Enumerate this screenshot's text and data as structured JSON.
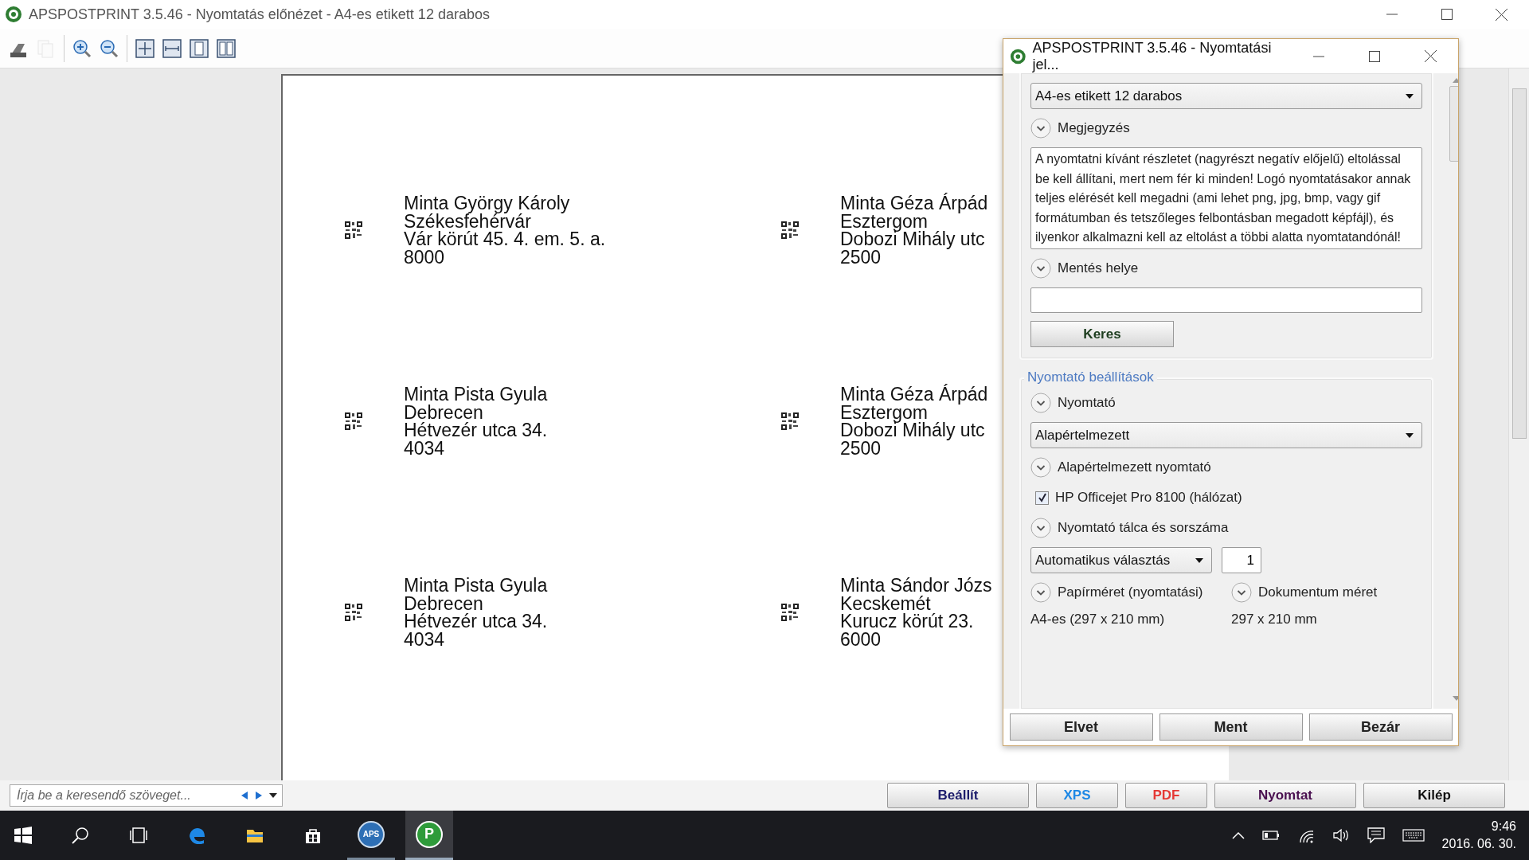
{
  "window": {
    "title": "APSPOSTPRINT 3.5.46 - Nyomtatás előnézet - A4-es etikett 12 darabos"
  },
  "toolbar": [
    {
      "kind": "print",
      "disabled": false
    },
    {
      "kind": "copy",
      "disabled": true
    },
    {
      "kind": "zoom-in",
      "disabled": false
    },
    {
      "kind": "zoom-out",
      "disabled": false
    },
    {
      "kind": "fit-page",
      "disabled": false
    },
    {
      "kind": "fit-width",
      "disabled": false
    },
    {
      "kind": "one-page",
      "disabled": false
    },
    {
      "kind": "two-pages",
      "disabled": false
    }
  ],
  "labels": [
    {
      "lines": [
        "Minta György Károly",
        "Székesfehérvár",
        "Vár körút 45. 4. em. 5. a.",
        "8000"
      ]
    },
    {
      "lines": [
        "Minta Géza Árpád",
        "Esztergom",
        "Dobozi Mihály utc",
        "2500"
      ]
    },
    {
      "lines": [
        "Minta Pista Gyula",
        "Debrecen",
        "Hétvezér utca 34.",
        "4034"
      ]
    },
    {
      "lines": [
        "Minta Géza Árpád",
        "Esztergom",
        "Dobozi Mihály utc",
        "2500"
      ]
    },
    {
      "lines": [
        "Minta Pista Gyula",
        "Debrecen",
        "Hétvezér utca 34.",
        "4034"
      ]
    },
    {
      "lines": [
        "Minta Sándor Józs",
        "Kecskemét",
        "Kurucz körút 23.",
        "6000"
      ]
    }
  ],
  "dialog": {
    "title": "APSPOSTPRINT 3.5.46 - Nyomtatási jel...",
    "template": "A4-es etikett 12 darabos",
    "note_heading": "Megjegyzés",
    "note": "A nyomtatni kívánt részletet (nagyrészt negatív előjelű) eltolással be kell állítani, mert nem fér ki minden! Logó nyomtatásakor annak teljes elérését kell megadni (ami lehet png, jpg, bmp, vagy gif formátumban és tetszőleges felbontásban megadott képfájl), és ilyenkor alkalmazni kell az eltolást a többi alatta nyomtatandónál!",
    "save_heading": "Mentés helye",
    "browse_button": "Keres",
    "printer_group": {
      "title": "Nyomtató beállítások",
      "printer_heading": "Nyomtató",
      "printer": "Alapértelmezett",
      "default_heading": "Alapértelmezett nyomtató",
      "default_printer": {
        "label": "HP Officejet Pro 8100 (hálózat)",
        "checked": true
      },
      "tray_heading": "Nyomtató tálca és sorszáma",
      "tray": "Automatikus választás",
      "copy_number": "1",
      "paper_heading": "Papírméret (nyomtatási)",
      "paper_size": "A4-es (297 x 210 mm)",
      "document_heading": "Dokumentum méret",
      "document_size": "297 x 210 mm"
    },
    "buttons": [
      "Elvet",
      "Ment",
      "Bezár"
    ]
  },
  "bottom_bar": {
    "search": {
      "placeholder": "Írja be a keresendő szöveget..."
    },
    "buttons": [
      {
        "label": "Beállít",
        "color": "#1c1c6b"
      },
      {
        "label": "XPS",
        "color": "#1e88e5"
      },
      {
        "label": "PDF",
        "color": "#e53935"
      },
      {
        "label": "Nyomtat",
        "color": "#4a1050"
      },
      {
        "label": "Kilép",
        "color": "#111111"
      }
    ]
  },
  "taskbar": {
    "apps": [
      {
        "kind": "start",
        "selected": false
      },
      {
        "kind": "search",
        "selected": false
      },
      {
        "kind": "task-view",
        "selected": false
      },
      {
        "kind": "edge",
        "selected": false
      },
      {
        "kind": "explorer",
        "selected": false
      },
      {
        "kind": "store",
        "selected": false
      },
      {
        "kind": "aps",
        "label": "APS",
        "selected": false
      },
      {
        "kind": "p",
        "label": "P",
        "selected": true
      }
    ],
    "time": "9:46",
    "date": "2016. 06. 30."
  }
}
